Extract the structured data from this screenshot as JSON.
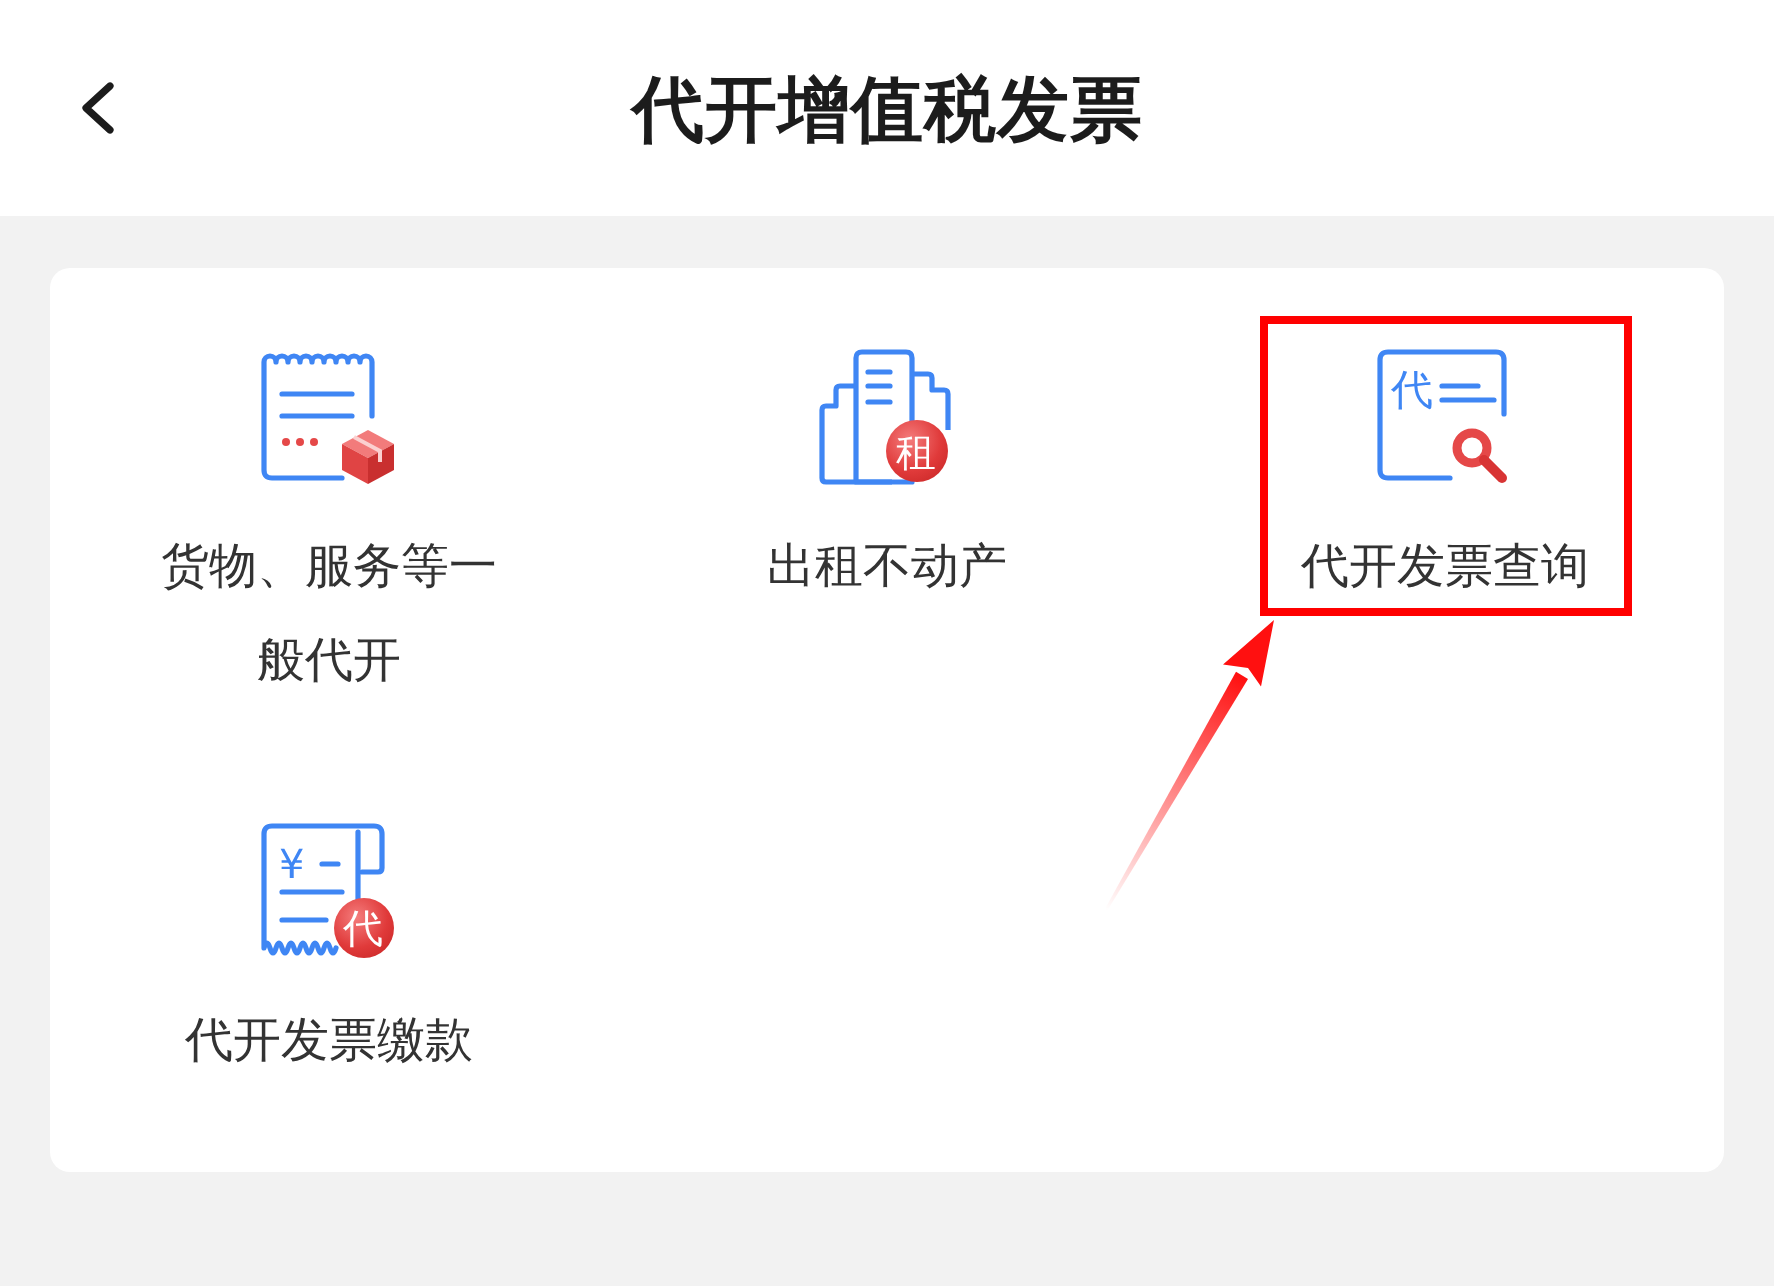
{
  "header": {
    "title": "代开增值税发票"
  },
  "menu": {
    "items": [
      {
        "label": "货物、服务等一般代开",
        "kind": "goods-receipt",
        "highlighted": false
      },
      {
        "label": "出租不动产",
        "kind": "building",
        "badge": "租",
        "highlighted": false
      },
      {
        "label": "代开发票查询",
        "kind": "query",
        "mark": "代",
        "highlighted": true
      },
      {
        "label": "代开发票缴款",
        "kind": "payment",
        "mark": "¥",
        "badge": "代",
        "highlighted": false
      }
    ]
  }
}
